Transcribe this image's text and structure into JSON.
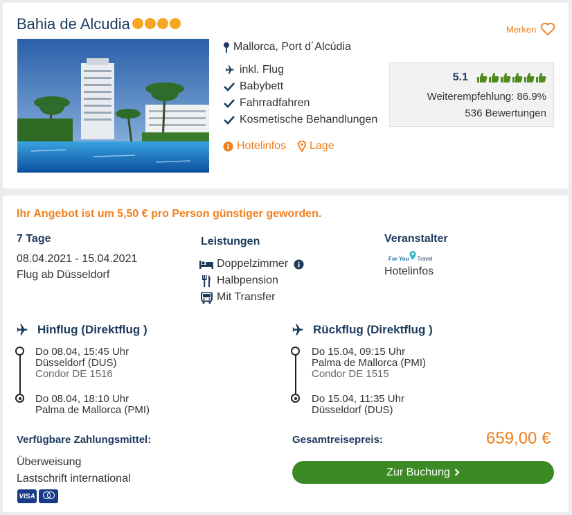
{
  "hotel": {
    "name": "Bahia de Alcudia",
    "stars": 4,
    "merken_label": "Merken",
    "location": "Mallorca, Port d´Alcúdia",
    "features": [
      {
        "icon": "plane-icon",
        "label": "inkl. Flug"
      },
      {
        "icon": "check-icon",
        "label": "Babybett"
      },
      {
        "icon": "check-icon",
        "label": "Fahrradfahren"
      },
      {
        "icon": "check-icon",
        "label": "Kosmetische Behandlungen"
      }
    ],
    "links": {
      "hotelinfos": "Hotelinfos",
      "lage": "Lage"
    },
    "rating": {
      "score": "5.1",
      "thumbs": 6,
      "recommendation": "Weiterempfehlung: 86.9%",
      "reviews": "536 Bewertungen"
    }
  },
  "offer": {
    "promo": "Ihr Angebot ist um 5,50 € pro Person günstiger geworden.",
    "duration": "7 Tage",
    "dates": "08.04.2021 - 15.04.2021",
    "departure": "Flug ab Düsseldorf",
    "services_heading": "Leistungen",
    "services": [
      {
        "icon": "bed-icon",
        "label": "Doppelzimmer"
      },
      {
        "icon": "utensils-icon",
        "label": "Halbpension"
      },
      {
        "icon": "bus-icon",
        "label": "Mit Transfer"
      }
    ],
    "operator_heading": "Veranstalter",
    "operator_logo_text": "For You Travel",
    "operator_link": "Hotelinfos",
    "outbound": {
      "title": "Hinflug (Direktflug )",
      "dep_time": "Do 08.04, 15:45 Uhr",
      "dep_airport": "Düsseldorf (DUS)",
      "carrier": "Condor DE 1516",
      "arr_time": "Do 08.04, 18:10 Uhr",
      "arr_airport": "Palma de Mallorca (PMI)"
    },
    "inbound": {
      "title": "Rückflug (Direktflug )",
      "dep_time": "Do 15.04, 09:15 Uhr",
      "dep_airport": "Palma de Mallorca (PMI)",
      "carrier": "Condor DE 1515",
      "arr_time": "Do 15.04, 11:35 Uhr",
      "arr_airport": "Düsseldorf (DUS)"
    },
    "payment_heading": "Verfügbare Zahlungsmittel:",
    "payment_methods": [
      "Überweisung",
      "Lastschrift international"
    ],
    "card_logo_visa": "VISA",
    "total_label": "Gesamtreisepreis:",
    "total_price": "659,00 €",
    "book_button": "Zur Buchung"
  },
  "colors": {
    "accent": "#f07e1a",
    "navy": "#1b3a5c",
    "button": "#3b8a23",
    "thumb": "#4e8a1e"
  }
}
